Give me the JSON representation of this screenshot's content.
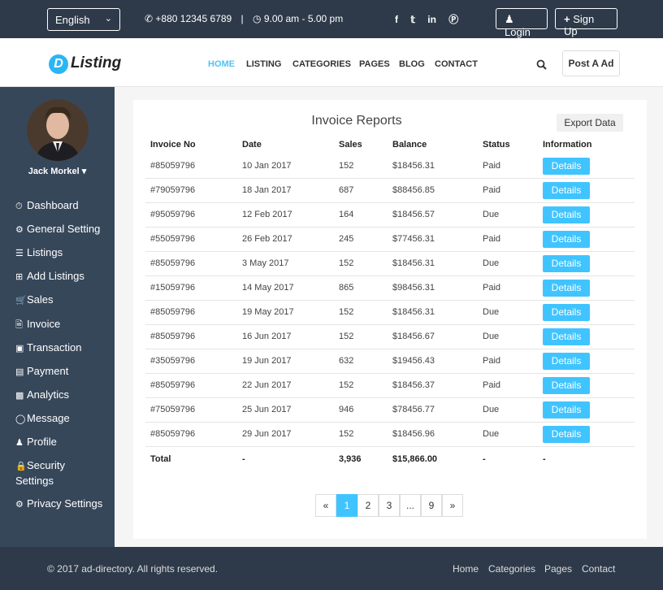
{
  "topbar": {
    "language": "English",
    "phone": "+880 12345 6789",
    "separator": "|",
    "hours": "9.00 am - 5.00 pm",
    "login": "Login",
    "signup": "Sign Up"
  },
  "header": {
    "logo_letter": "D",
    "logo_text": "Listing",
    "nav": [
      "HOME",
      "LISTING",
      "CATEGORIES",
      "PAGES",
      "BLOG",
      "CONTACT"
    ],
    "post_ad": "Post A Ad"
  },
  "sidebar": {
    "user_name": "Jack Morkel",
    "items": [
      "Dashboard",
      "General Setting",
      "Listings",
      "Add Listings",
      "Sales",
      "Invoice",
      "Transaction",
      "Payment",
      "Analytics",
      "Message",
      "Profile",
      "Security Settings",
      "Privacy Settings"
    ]
  },
  "report": {
    "title": "Invoice Reports",
    "export": "Export Data",
    "headers": [
      "Invoice No",
      "Date",
      "Sales",
      "Balance",
      "Status",
      "Information"
    ],
    "details_label": "Details",
    "rows": [
      {
        "invoice": "#85059796",
        "date": "10 Jan 2017",
        "sales": "152",
        "balance": "$18456.31",
        "status": "Paid"
      },
      {
        "invoice": "#79059796",
        "date": "18 Jan 2017",
        "sales": "687",
        "balance": "$88456.85",
        "status": "Paid"
      },
      {
        "invoice": "#95059796",
        "date": "12 Feb 2017",
        "sales": "164",
        "balance": "$18456.57",
        "status": "Due"
      },
      {
        "invoice": "#55059796",
        "date": "26 Feb 2017",
        "sales": "245",
        "balance": "$77456.31",
        "status": "Paid"
      },
      {
        "invoice": "#85059796",
        "date": "3 May 2017",
        "sales": "152",
        "balance": "$18456.31",
        "status": "Due"
      },
      {
        "invoice": "#15059796",
        "date": "14 May 2017",
        "sales": "865",
        "balance": "$98456.31",
        "status": "Paid"
      },
      {
        "invoice": "#85059796",
        "date": "19 May 2017",
        "sales": "152",
        "balance": "$18456.31",
        "status": "Due"
      },
      {
        "invoice": "#85059796",
        "date": "16 Jun 2017",
        "sales": "152",
        "balance": "$18456.67",
        "status": "Due"
      },
      {
        "invoice": "#35059796",
        "date": "19 Jun 2017",
        "sales": "632",
        "balance": "$19456.43",
        "status": "Paid"
      },
      {
        "invoice": "#85059796",
        "date": "22 Jun 2017",
        "sales": "152",
        "balance": "$18456.37",
        "status": "Paid"
      },
      {
        "invoice": "#75059796",
        "date": "25 Jun 2017",
        "sales": "946",
        "balance": "$78456.77",
        "status": "Due"
      },
      {
        "invoice": "#85059796",
        "date": "29 Jun 2017",
        "sales": "152",
        "balance": "$18456.96",
        "status": "Due"
      }
    ],
    "total": {
      "label": "Total",
      "date": "-",
      "sales": "3,936",
      "balance": "$15,866.00",
      "status": "-",
      "info": "-"
    }
  },
  "pagination": [
    "«",
    "1",
    "2",
    "3",
    "...",
    "9",
    "»"
  ],
  "footer": {
    "copyright": "© 2017 ad-directory. All rights reserved.",
    "links": [
      "Home",
      "Categories",
      "Pages",
      "Contact"
    ]
  },
  "colors": {
    "accent": "#40c4ff",
    "topbar": "#2e3a4a",
    "sidebar": "#37475a"
  },
  "icons": {
    "phone": "phone-icon",
    "clock": "clock-icon",
    "facebook": "facebook-icon",
    "twitter": "twitter-icon",
    "linkedin": "linkedin-icon",
    "pinterest": "pinterest-icon",
    "user": "user-icon",
    "plus": "plus-icon",
    "search": "search-icon"
  }
}
